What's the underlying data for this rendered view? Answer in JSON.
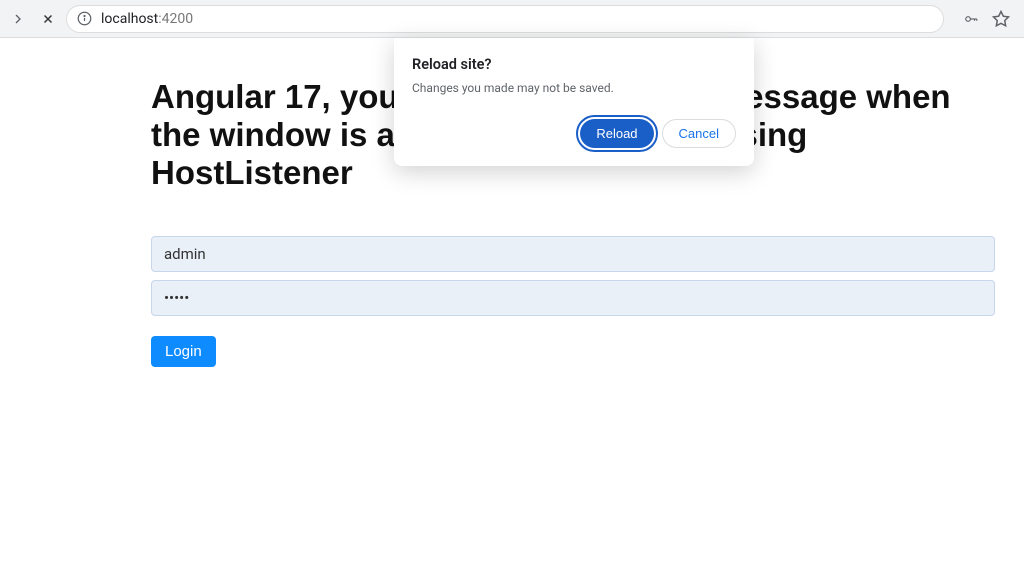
{
  "browser": {
    "url_host": "localhost",
    "url_port": ":4200"
  },
  "page": {
    "title": "Angular 17, you can alert a warning message when the window is about to be unloaded using HostListener"
  },
  "form": {
    "username_value": "admin",
    "password_value": "•••••",
    "login_label": "Login"
  },
  "dialog": {
    "title": "Reload site?",
    "message": "Changes you made may not be saved.",
    "reload_label": "Reload",
    "cancel_label": "Cancel"
  }
}
